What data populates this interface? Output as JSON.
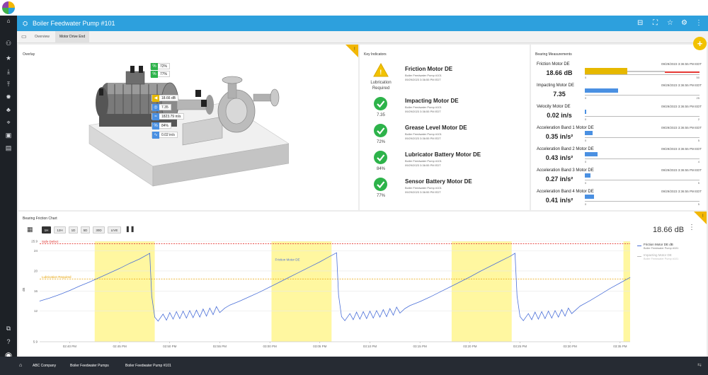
{
  "header": {
    "title": "Boiler Feedwater Pump #101"
  },
  "tabs": [
    {
      "label": "Overview"
    },
    {
      "label": "Motor Drive End"
    }
  ],
  "overlay": {
    "title": "Overlay",
    "badges": [
      {
        "value": "72%",
        "icon": "percent-icon",
        "color": "#2db34a"
      },
      {
        "value": "77%",
        "icon": "percent-icon",
        "color": "#2db34a"
      },
      {
        "value": "18.66 dB",
        "icon": "speaker-icon",
        "color": "#e6b800"
      },
      {
        "value": "7.35",
        "icon": "gauge-icon",
        "color": "#4a90e2"
      },
      {
        "value": "1823.79 m/s",
        "icon": "wave-icon",
        "color": "#4a90e2"
      },
      {
        "value": "84%",
        "icon": "percent-icon",
        "color": "#4a90e2"
      },
      {
        "value": "0.02 in/s",
        "icon": "vibration-icon",
        "color": "#4a90e2"
      }
    ]
  },
  "key_indicators": {
    "title": "Key Indicators",
    "items": [
      {
        "name": "Friction Motor DE",
        "asset": "Boiler Feedwater Pump #101",
        "time": "09/29/2023 3:36:55 PM EDT",
        "status_lines": [
          "Lubrication",
          "Required"
        ],
        "value": "",
        "status": "warning"
      },
      {
        "name": "Impacting Motor DE",
        "asset": "Boiler Feedwater Pump #101",
        "time": "09/29/2023 3:36:55 PM EDT",
        "status_lines": [],
        "value": "7.35",
        "status": "ok"
      },
      {
        "name": "Grease Level Motor DE",
        "asset": "Boiler Feedwater Pump #101",
        "time": "09/29/2023 3:36:55 PM EDT",
        "status_lines": [],
        "value": "72%",
        "status": "ok"
      },
      {
        "name": "Lubricator Battery Motor DE",
        "asset": "Boiler Feedwater Pump #101",
        "time": "09/29/2023 3:36:55 PM EDT",
        "status_lines": [],
        "value": "84%",
        "status": "ok"
      },
      {
        "name": "Sensor Battery Motor DE",
        "asset": "Boiler Feedwater Pump #101",
        "time": "09/29/2023 3:36:55 PM EDT",
        "status_lines": [],
        "value": "77%",
        "status": "ok"
      }
    ]
  },
  "bearing_measurements": {
    "title": "Bearing Measurements",
    "items": [
      {
        "name": "Friction Motor DE",
        "value": "18.66 dB",
        "time": "09/29/2023 3:36:55 PM EDT",
        "min": "0",
        "max": "50",
        "level": 0.37,
        "color": "#e6b800",
        "zone": "warning"
      },
      {
        "name": "Impacting Motor DE",
        "value": "7.35",
        "time": "09/29/2023 3:36:55 PM EDT",
        "min": "0",
        "max": "25",
        "level": 0.29,
        "color": "#4a90e2",
        "zone": "normal"
      },
      {
        "name": "Velocity Motor DE",
        "value": "0.02 in/s",
        "time": "09/29/2023 3:36:55 PM EDT",
        "min": "0",
        "max": "2",
        "level": 0.01,
        "color": "#4a90e2",
        "zone": "normal"
      },
      {
        "name": "Acceleration Band 1 Motor DE",
        "value": "0.35 in/s²",
        "time": "09/29/2023 3:36:55 PM EDT",
        "min": "0",
        "max": "5",
        "level": 0.07,
        "color": "#4a90e2",
        "zone": "normal"
      },
      {
        "name": "Acceleration Band 2 Motor DE",
        "value": "0.43 in/s²",
        "time": "09/29/2023 3:36:55 PM EDT",
        "min": "0",
        "max": "4",
        "level": 0.11,
        "color": "#4a90e2",
        "zone": "normal"
      },
      {
        "name": "Acceleration Band 3 Motor DE",
        "value": "0.27 in/s²",
        "time": "09/29/2023 3:36:55 PM EDT",
        "min": "0",
        "max": "5",
        "level": 0.05,
        "color": "#4a90e2",
        "zone": "normal"
      },
      {
        "name": "Acceleration Band 4 Motor DE",
        "value": "0.41 in/s²",
        "time": "09/29/2023 3:36:55 PM EDT",
        "min": "0",
        "max": "5",
        "level": 0.08,
        "color": "#4a90e2",
        "zone": "normal"
      }
    ]
  },
  "friction_chart": {
    "title": "Bearing Friction Chart",
    "ranges": [
      "1H",
      "12H",
      "1D",
      "5D",
      "30D",
      "LIVE"
    ],
    "active_range": "1H",
    "current_value": "18.66 dB",
    "legend": [
      {
        "name": "Friction Motor DE dB",
        "asset": "Boiler Feedwater Pump #101",
        "color": "#4a6fd8",
        "active": true
      },
      {
        "name": "Impacting Motor DE",
        "asset": "Boiler Feedwater Pump #101",
        "color": "#bbbbbb",
        "active": false
      }
    ],
    "series_label": "Friction Motor DE"
  },
  "chart_data": {
    "type": "line",
    "ylabel": "dB",
    "ylim": [
      5.9,
      25.9
    ],
    "yticks": [
      "25.9",
      "24",
      "20",
      "16",
      "12",
      "5.9"
    ],
    "xlim": [
      "15:37:00",
      "16:36:00"
    ],
    "xticks": [
      {
        "t": "15:40:00",
        "label": "02:40 PM"
      },
      {
        "t": "15:45:00",
        "label": "02:45 PM"
      },
      {
        "t": "15:50:00",
        "label": "02:50 PM"
      },
      {
        "t": "15:55:00",
        "label": "02:55 PM"
      },
      {
        "t": "16:00:00",
        "label": "03:00 PM"
      },
      {
        "t": "16:05:00",
        "label": "03:05 PM"
      },
      {
        "t": "16:10:00",
        "label": "03:10 PM"
      },
      {
        "t": "16:15:00",
        "label": "03:15 PM"
      },
      {
        "t": "16:20:00",
        "label": "03:20 PM"
      },
      {
        "t": "16:25:00",
        "label": "03:25 PM"
      },
      {
        "t": "16:30:00",
        "label": "03:30 PM"
      },
      {
        "t": "16:35:00",
        "label": "03:35 PM"
      }
    ],
    "thresholds": [
      {
        "label": "Safe Defect",
        "value": 25.4,
        "color": "#e53935"
      },
      {
        "label": "Lubrication Required",
        "value": 18.4,
        "color": "#e6a100"
      }
    ],
    "bands": [
      {
        "x0": "15:42:30",
        "x1": "15:48:30",
        "color": "#fff7a0"
      },
      {
        "x0": "16:00:10",
        "x1": "16:06:10",
        "color": "#fff7a0"
      },
      {
        "x0": "16:18:10",
        "x1": "16:24:10",
        "color": "#fff7a0"
      },
      {
        "x0": "16:35:20",
        "x1": "16:36:00",
        "color": "#fff7a0"
      }
    ],
    "series": [
      {
        "name": "Friction Motor DE",
        "color": "#4a6fd8",
        "points": [
          [
            "15:37:00",
            14.0
          ],
          [
            "15:38:00",
            14.6
          ],
          [
            "15:39:00",
            15.3
          ],
          [
            "15:40:00",
            16.1
          ],
          [
            "15:41:00",
            17.0
          ],
          [
            "15:42:00",
            17.8
          ],
          [
            "15:43:00",
            18.7
          ],
          [
            "15:44:00",
            19.6
          ],
          [
            "15:45:00",
            20.5
          ],
          [
            "15:46:00",
            21.5
          ],
          [
            "15:47:00",
            22.4
          ],
          [
            "15:48:00",
            23.5
          ],
          [
            "15:48:12",
            15.0
          ],
          [
            "15:48:30",
            10.8
          ],
          [
            "15:48:50",
            10.0
          ],
          [
            "15:49:20",
            11.4
          ],
          [
            "15:49:40",
            10.2
          ],
          [
            "15:50:00",
            11.7
          ],
          [
            "15:50:20",
            10.4
          ],
          [
            "15:50:40",
            11.9
          ],
          [
            "15:51:00",
            10.5
          ],
          [
            "15:51:20",
            12.0
          ],
          [
            "15:51:40",
            10.6
          ],
          [
            "15:52:00",
            12.1
          ],
          [
            "15:52:20",
            10.7
          ],
          [
            "15:52:40",
            12.2
          ],
          [
            "15:53:00",
            10.8
          ],
          [
            "15:53:20",
            12.4
          ],
          [
            "15:53:40",
            11.0
          ],
          [
            "15:54:00",
            12.6
          ],
          [
            "15:54:20",
            11.3
          ],
          [
            "15:54:40",
            12.9
          ],
          [
            "15:55:00",
            11.7
          ],
          [
            "15:55:30",
            12.6
          ],
          [
            "15:56:00",
            13.2
          ],
          [
            "15:57:00",
            14.0
          ],
          [
            "15:58:00",
            14.9
          ],
          [
            "15:59:00",
            15.8
          ],
          [
            "16:00:00",
            16.8
          ],
          [
            "16:01:00",
            17.8
          ],
          [
            "16:02:00",
            18.8
          ],
          [
            "16:03:00",
            19.8
          ],
          [
            "16:04:00",
            20.8
          ],
          [
            "16:05:00",
            21.8
          ],
          [
            "16:06:00",
            22.9
          ],
          [
            "16:06:40",
            23.6
          ],
          [
            "16:06:52",
            15.2
          ],
          [
            "16:07:10",
            10.9
          ],
          [
            "16:07:30",
            10.1
          ],
          [
            "16:08:00",
            11.5
          ],
          [
            "16:08:20",
            10.3
          ],
          [
            "16:08:40",
            11.8
          ],
          [
            "16:09:00",
            10.4
          ],
          [
            "16:09:20",
            11.9
          ],
          [
            "16:09:40",
            10.5
          ],
          [
            "16:10:00",
            12.0
          ],
          [
            "16:10:20",
            10.6
          ],
          [
            "16:10:40",
            12.1
          ],
          [
            "16:11:00",
            10.8
          ],
          [
            "16:11:20",
            12.3
          ],
          [
            "16:11:40",
            10.9
          ],
          [
            "16:12:00",
            12.5
          ],
          [
            "16:12:20",
            11.2
          ],
          [
            "16:12:40",
            12.8
          ],
          [
            "16:13:00",
            11.6
          ],
          [
            "16:13:30",
            12.5
          ],
          [
            "16:14:00",
            13.1
          ],
          [
            "16:15:00",
            13.9
          ],
          [
            "16:16:00",
            14.8
          ],
          [
            "16:17:00",
            15.8
          ],
          [
            "16:18:00",
            16.8
          ],
          [
            "16:19:00",
            17.8
          ],
          [
            "16:20:00",
            18.8
          ],
          [
            "16:21:00",
            19.9
          ],
          [
            "16:22:00",
            20.9
          ],
          [
            "16:23:00",
            21.9
          ],
          [
            "16:24:00",
            22.9
          ],
          [
            "16:24:30",
            23.5
          ],
          [
            "16:24:42",
            15.0
          ],
          [
            "16:25:00",
            10.9
          ],
          [
            "16:25:20",
            10.1
          ],
          [
            "16:25:50",
            11.5
          ],
          [
            "16:26:10",
            10.3
          ],
          [
            "16:26:30",
            11.8
          ],
          [
            "16:26:50",
            10.4
          ],
          [
            "16:27:10",
            11.9
          ],
          [
            "16:27:30",
            10.5
          ],
          [
            "16:27:50",
            12.0
          ],
          [
            "16:28:10",
            10.6
          ],
          [
            "16:28:30",
            12.1
          ],
          [
            "16:28:50",
            10.8
          ],
          [
            "16:29:10",
            12.3
          ],
          [
            "16:29:30",
            11.0
          ],
          [
            "16:29:50",
            12.6
          ],
          [
            "16:30:10",
            11.5
          ],
          [
            "16:30:40",
            12.4
          ],
          [
            "16:31:00",
            13.0
          ],
          [
            "16:32:00",
            14.1
          ],
          [
            "16:33:00",
            15.3
          ],
          [
            "16:34:00",
            16.5
          ],
          [
            "16:35:00",
            17.6
          ],
          [
            "16:36:00",
            18.7
          ]
        ]
      }
    ]
  },
  "footer": {
    "breadcrumbs": [
      "ABC Company",
      "Boiler Feedwater Pumps",
      "Boiler Feedwater Pump #101"
    ]
  }
}
